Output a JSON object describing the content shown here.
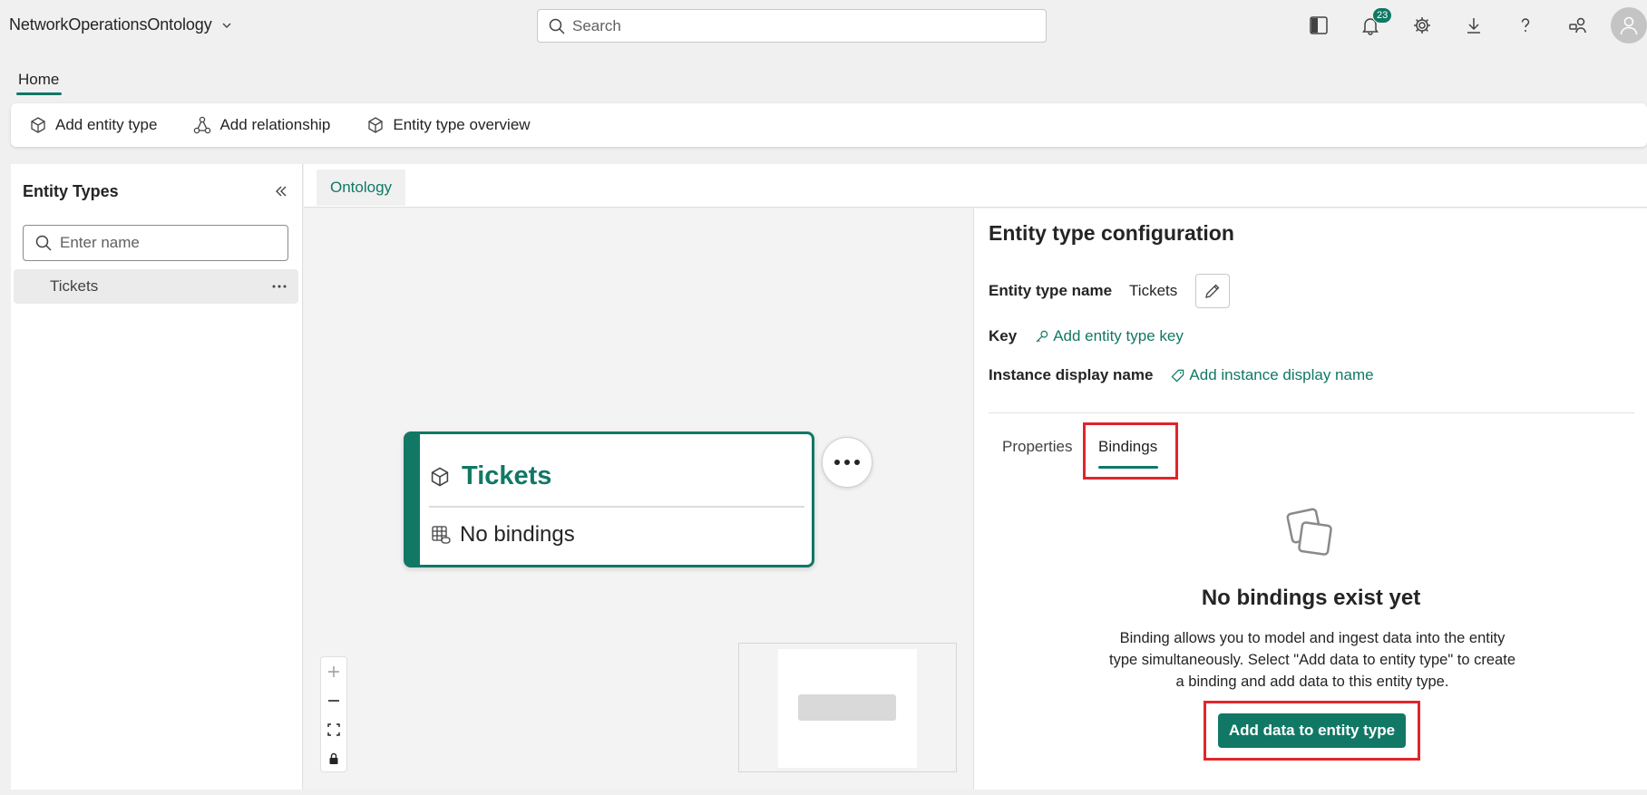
{
  "colors": {
    "accent": "#117865",
    "highlight": "#e0262c"
  },
  "app": {
    "title": "NetworkOperationsOntology"
  },
  "search": {
    "placeholder": "Search"
  },
  "top_icons": [
    "panel-icon",
    "bell-icon",
    "gear-icon",
    "download-icon",
    "help-icon",
    "share-people-icon",
    "avatar"
  ],
  "notifications": {
    "count": "23"
  },
  "home_tab": {
    "label": "Home"
  },
  "ribbon": {
    "add_entity_type": "Add entity type",
    "add_relationship": "Add relationship",
    "entity_type_overview": "Entity type overview"
  },
  "left_panel": {
    "title": "Entity Types",
    "search_placeholder": "Enter name",
    "items": [
      {
        "label": "Tickets"
      }
    ]
  },
  "ontology_tab": {
    "label": "Ontology"
  },
  "canvas": {
    "node": {
      "title": "Tickets",
      "binding_status": "No bindings"
    },
    "zoom_controls": [
      "zoom-in",
      "zoom-out",
      "fit-view",
      "lock"
    ]
  },
  "config": {
    "title": "Entity type configuration",
    "name_label": "Entity type name",
    "name_value": "Tickets",
    "key_label": "Key",
    "key_link": "Add entity type key",
    "display_label": "Instance display name",
    "display_link": "Add instance display name",
    "tabs": [
      {
        "label": "Properties"
      },
      {
        "label": "Bindings",
        "selected": true
      }
    ],
    "empty_title": "No bindings exist yet",
    "empty_description": "Binding allows you to model and ingest data into the entity type simultaneously. Select \"Add data to entity type\" to create a binding and add data to this entity type.",
    "add_button": "Add data to entity type"
  }
}
